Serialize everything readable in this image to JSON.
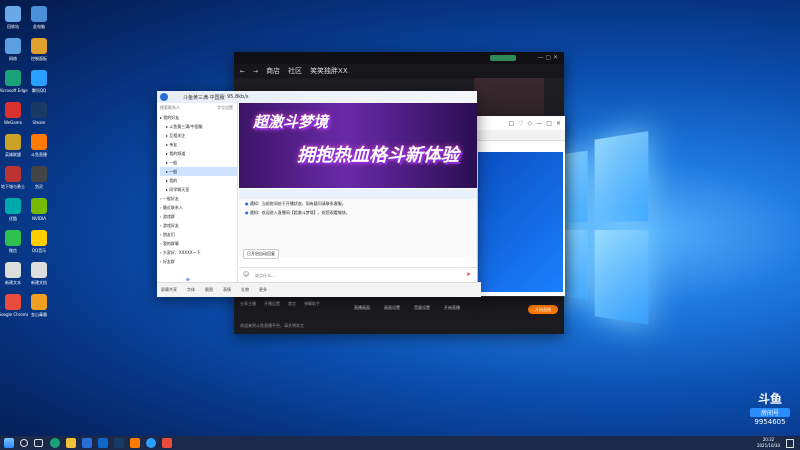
{
  "desktop": {
    "icons": [
      "回收站",
      "此电脑",
      "网络",
      "控制面板",
      "Microsoft Edge",
      "腾讯QQ",
      "WeGame",
      "Steam",
      "英雄联盟",
      "斗鱼直播",
      "地下城与勇士",
      "剑灵",
      "优酷",
      "NVIDIA",
      "微信",
      "QQ音乐",
      "新建文本",
      "新建文档",
      "Google Chrome",
      "金山毒霸"
    ]
  },
  "store_window": {
    "tabs": [
      "商店",
      "社区",
      "笑笑独胖XX"
    ],
    "toolbar_icons": [
      "▣",
      "★",
      "☺",
      "••"
    ],
    "bottom_labels": [
      "直播画面",
      "画面设置",
      "音量设置",
      "开始直播"
    ],
    "bottom_row2": [
      "分享主播",
      "开播设置",
      "禁言",
      "弹幕助手"
    ],
    "chat_line": "欢迎来到斗鱼直播平台，请文明发言",
    "start_button": "开始直播"
  },
  "qq_window": {
    "title": "斗鱼黄三满·中国服",
    "status": "95.8kb/s",
    "search_placeholder": "搜索联系人",
    "header_right": "字号设置",
    "tree": [
      "我的好友",
      "斗鱼黄三满/中国服",
      "互相关注",
      "亲友",
      "我的频道",
      "一般",
      "一般",
      "我的",
      "同学聊天室",
      "一般好友",
      "最近联系人",
      "游戏群",
      "游戏好友",
      "朋友们",
      "我的群聊",
      "大家好，XXXXX一下",
      "好友群"
    ],
    "banner_line1": "超激斗梦境",
    "banner_line2": "拥抱热血格斗新体验",
    "messages": [
      "通知：当前房间处于开播状态，如有疑问请联系客服。",
      "通知：欢迎进入直播间【超激斗梦境】，祝您观看愉快。"
    ],
    "quick_reply": "已开启自动回复",
    "input_placeholder": "说点什么...",
    "bottom_tools": [
      "屏幕共享",
      "字体",
      "截图",
      "表情",
      "礼物",
      "更多"
    ],
    "send_label": "发送"
  },
  "douyu_window": {
    "icons": [
      "□",
      "♡",
      "◇",
      "—",
      "□",
      "✕"
    ]
  },
  "watermark": {
    "brand": "斗鱼",
    "badge": "房间号",
    "room": "9954605"
  },
  "taskbar": {
    "time": "20:32",
    "date": "2021/10/30"
  }
}
